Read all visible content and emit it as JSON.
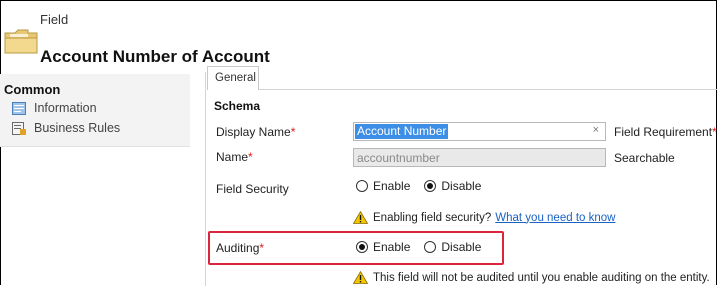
{
  "header": {
    "entity_type": "Field",
    "title": "Account Number of Account",
    "icon": "folder-icon"
  },
  "sidebar": {
    "heading": "Common",
    "items": [
      {
        "label": "Information",
        "icon": "information-icon"
      },
      {
        "label": "Business Rules",
        "icon": "business-rules-icon"
      }
    ]
  },
  "tabs": [
    {
      "label": "General",
      "active": true
    }
  ],
  "schema": {
    "heading": "Schema",
    "display_name": {
      "label": "Display Name",
      "required_marker": "*",
      "value": "Account Number",
      "clear_glyph": "×"
    },
    "field_requirement": {
      "label": "Field Requirement",
      "required_marker": "*"
    },
    "name": {
      "label": "Name",
      "required_marker": "*",
      "value": "accountnumber"
    },
    "searchable": {
      "label": "Searchable"
    },
    "field_security": {
      "label": "Field Security",
      "options": [
        "Enable",
        "Disable"
      ],
      "selected": "Disable",
      "warning_text": "Enabling field security?",
      "warning_link": "What you need to know"
    },
    "auditing": {
      "label": "Auditing",
      "required_marker": "*",
      "options": [
        "Enable",
        "Disable"
      ],
      "selected": "Enable",
      "warning_text": "This field will not be audited until you enable auditing on the entity."
    }
  },
  "colors": {
    "required": "#e31a1a",
    "highlight": "#d9263a",
    "selection": "#3d8ee6",
    "link": "#1a62c4",
    "warning": "#f2c500"
  }
}
